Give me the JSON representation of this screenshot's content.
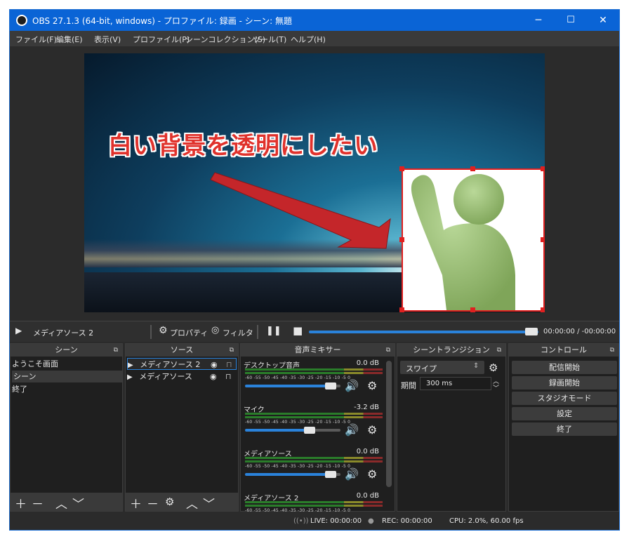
{
  "window": {
    "title": "OBS 27.1.3 (64-bit, windows) - プロファイル: 録画 - シーン: 無題",
    "minimize": "─",
    "maximize": "☐",
    "close": "✕"
  },
  "menu": [
    "ファイル(F)",
    "編集(E)",
    "表示(V)",
    "プロファイル(P)",
    "シーンコレクション(S)",
    "ツール(T)",
    "ヘルプ(H)"
  ],
  "preview": {
    "overlay_text": "白い背景を透明にしたい"
  },
  "media_controls": {
    "play_icon": "▶",
    "source_name": "メディアソース 2",
    "properties_label": "プロパティ",
    "filters_label": "フィルタ",
    "pause_icon": "❚❚",
    "stop_icon": "■",
    "seek_progress": 1.0,
    "time": "00:00:00 / -00:00:00"
  },
  "scenes": {
    "header": "シーン",
    "items": [
      "ようこそ画面",
      "シーン",
      "終了"
    ],
    "selected_index": 1
  },
  "sources": {
    "header": "ソース",
    "items": [
      {
        "name": "メディアソース 2",
        "visible": true,
        "locked": false
      },
      {
        "name": "メディアソース",
        "visible": true,
        "locked": true
      }
    ]
  },
  "mixer": {
    "header": "音声ミキサー",
    "scale": "-60 -55 -50 -45 -40 -35 -30 -25 -20 -15 -10  -5   0",
    "channels": [
      {
        "name": "デスクトップ音声",
        "db": "0.0 dB",
        "volume": 0.9
      },
      {
        "name": "マイク",
        "db": "-3.2 dB",
        "volume": 0.68
      },
      {
        "name": "メディアソース",
        "db": "0.0 dB",
        "volume": 0.9
      },
      {
        "name": "メディアソース 2",
        "db": "0.0 dB",
        "volume": 0.9
      }
    ]
  },
  "transitions": {
    "header": "シーントランジション",
    "selected": "スワイプ",
    "duration_label": "期間",
    "duration_value": "300 ms"
  },
  "controls": {
    "header": "コントロール",
    "buttons": [
      "配信開始",
      "録画開始",
      "スタジオモード",
      "設定",
      "終了"
    ]
  },
  "status": {
    "live": "LIVE: 00:00:00",
    "rec": "REC: 00:00:00",
    "cpu": "CPU: 2.0%, 60.00 fps"
  },
  "colors": {
    "accent": "#2a82da",
    "selection": "#e02020",
    "titlebar": "#0a64d6"
  }
}
